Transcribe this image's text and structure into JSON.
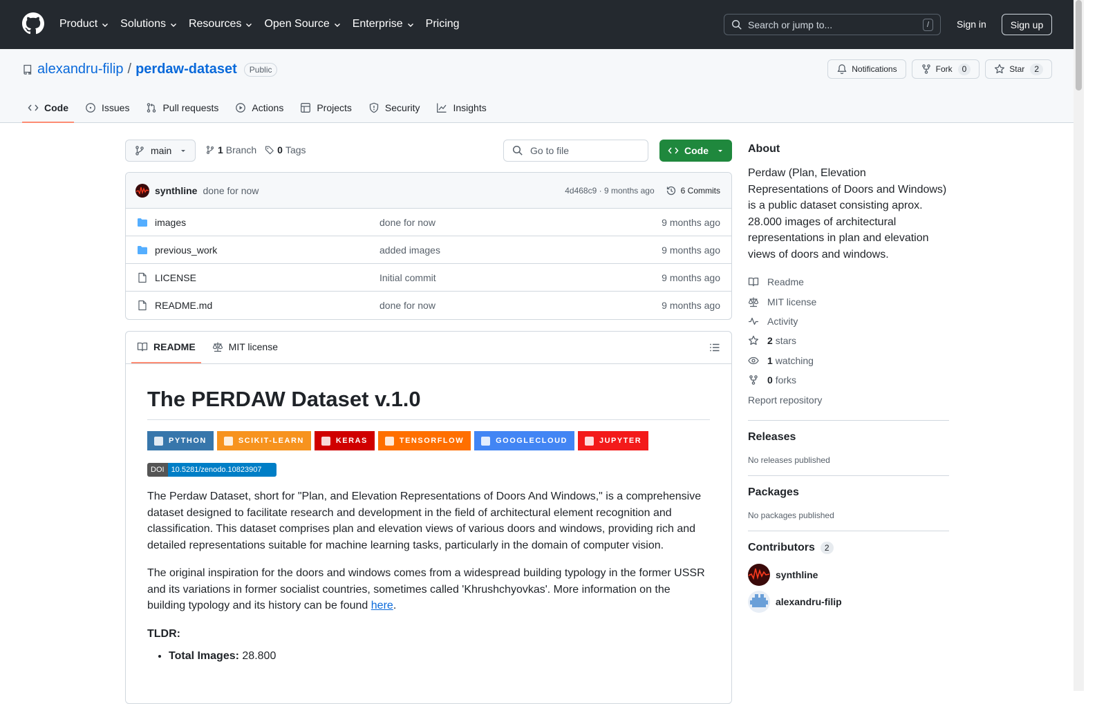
{
  "header": {
    "nav": [
      "Product",
      "Solutions",
      "Resources",
      "Open Source",
      "Enterprise",
      "Pricing"
    ],
    "search_placeholder": "Search or jump to...",
    "search_shortcut": "/",
    "sign_in": "Sign in",
    "sign_up": "Sign up"
  },
  "repo": {
    "owner": "alexandru-filip",
    "separator": "/",
    "name": "perdaw-dataset",
    "visibility": "Public",
    "notifications_label": "Notifications",
    "fork_label": "Fork",
    "fork_count": "0",
    "star_label": "Star",
    "star_count": "2",
    "tabs": [
      "Code",
      "Issues",
      "Pull requests",
      "Actions",
      "Projects",
      "Security",
      "Insights"
    ]
  },
  "toolbar": {
    "branch": "main",
    "branch_count": "1",
    "branch_label": "Branch",
    "tag_count": "0",
    "tag_label": "Tags",
    "goto_placeholder": "Go to file",
    "code_label": "Code"
  },
  "commit": {
    "author": "synthline",
    "message": "done for now",
    "hash_time": "4d468c9 · 9 months ago",
    "commits_label": "6 Commits"
  },
  "files": [
    {
      "name": "images",
      "message": "done for now",
      "date": "9 months ago",
      "type": "folder"
    },
    {
      "name": "previous_work",
      "message": "added images",
      "date": "9 months ago",
      "type": "folder"
    },
    {
      "name": "LICENSE",
      "message": "Initial commit",
      "date": "9 months ago",
      "type": "file"
    },
    {
      "name": "README.md",
      "message": "done for now",
      "date": "9 months ago",
      "type": "file"
    }
  ],
  "readme": {
    "tab_readme": "README",
    "tab_license": "MIT license",
    "title": "The PERDAW Dataset v.1.0",
    "badges": [
      {
        "label": "PYTHON",
        "color": "#3776ab"
      },
      {
        "label": "SCIKIT-LEARN",
        "color": "#f7931e"
      },
      {
        "label": "KERAS",
        "color": "#d00000"
      },
      {
        "label": "TENSORFLOW",
        "color": "#ff6f00"
      },
      {
        "label": "GOOGLECLOUD",
        "color": "#4285f4"
      },
      {
        "label": "JUPYTER",
        "color": "#f31a1a"
      }
    ],
    "doi_label": "DOI",
    "doi_value": "10.5281/zenodo.10823907",
    "para1": "The Perdaw Dataset, short for \"Plan, and Elevation Representations of Doors And Windows,\" is a comprehensive dataset designed to facilitate research and development in the field of architectural element recognition and classification. This dataset comprises plan and elevation views of various doors and windows, providing rich and detailed representations suitable for machine learning tasks, particularly in the domain of computer vision.",
    "para2": "The original inspiration for the doors and windows comes from a widespread building typology in the former USSR and its variations in former socialist countries, sometimes called 'Khrushchyovkas'. More information on the building typology and its history can be found",
    "para2_link": "here",
    "para2_end": ".",
    "tldr": "TLDR:",
    "list_key": "Total Images:",
    "list_val": " 28.800"
  },
  "sidebar": {
    "about_title": "About",
    "about_text": "Perdaw (Plan, Elevation Representations of Doors and Windows) is a public dataset consisting aprox. 28.000 images of architectural representations in plan and elevation views of doors and windows.",
    "readme": "Readme",
    "license": "MIT license",
    "activity": "Activity",
    "stars_count": "2",
    "stars_label": "stars",
    "watching_count": "1",
    "watching_label": "watching",
    "forks_count": "0",
    "forks_label": "forks",
    "report": "Report repository",
    "releases_title": "Releases",
    "releases_text": "No releases published",
    "packages_title": "Packages",
    "packages_text": "No packages published",
    "contributors_title": "Contributors",
    "contributors_count": "2",
    "contributors": [
      "synthline",
      "alexandru-filip"
    ]
  }
}
